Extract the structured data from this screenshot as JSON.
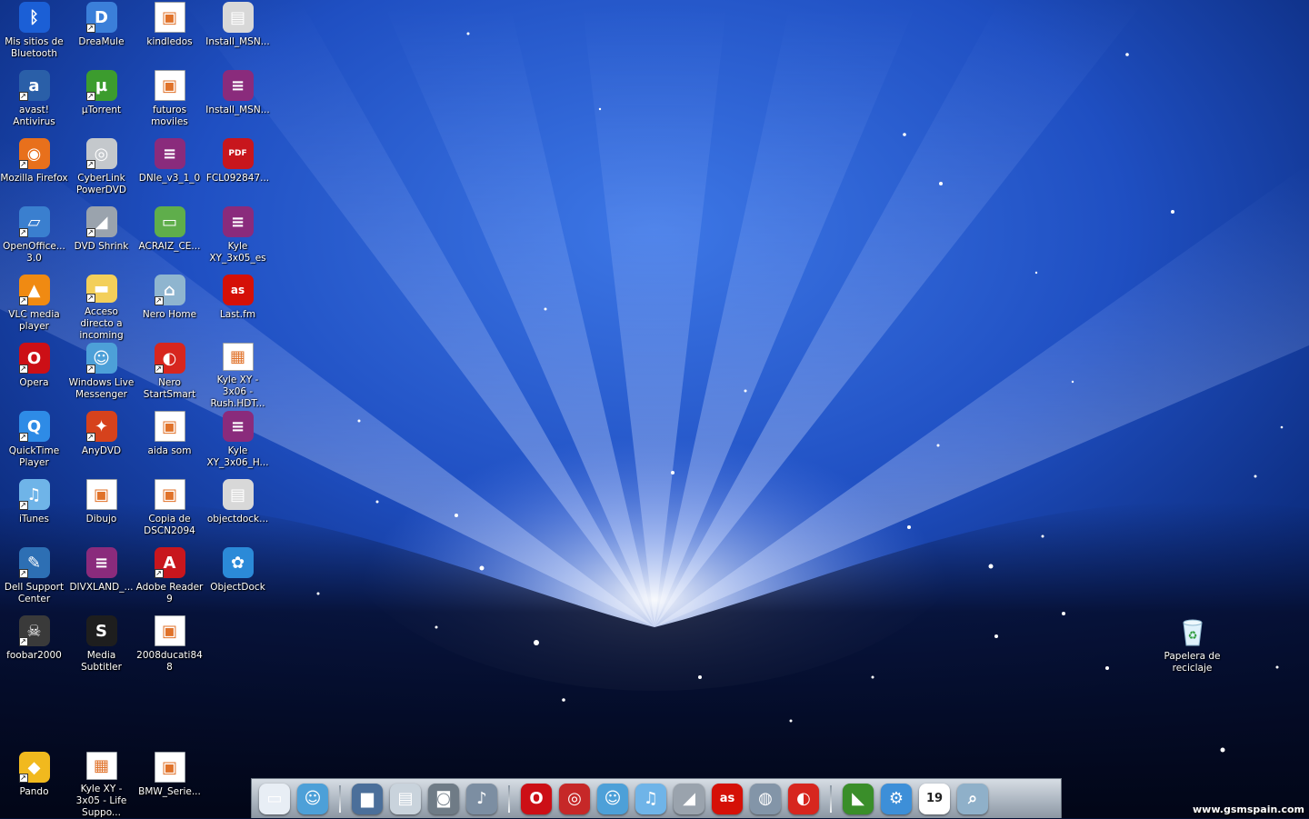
{
  "desktop": {
    "icons": [
      {
        "name": "bluetooth-icon",
        "label": "Mis sitios de Bluetooth",
        "shortcut": false,
        "color": "#1b5fd6",
        "glyph": "ᛒ"
      },
      {
        "name": "dreamule-icon",
        "label": "DreaMule",
        "shortcut": true,
        "color": "#3b7fd9",
        "glyph": "D"
      },
      {
        "name": "image-file-icon",
        "label": "kindledos",
        "shortcut": false,
        "color": "#ffffff",
        "glyph": "▣"
      },
      {
        "name": "installer-icon",
        "label": "Install_MSN...",
        "shortcut": false,
        "color": "#d8d8d8",
        "glyph": "▤"
      },
      {
        "name": "avast-icon",
        "label": "avast! Antivirus",
        "shortcut": true,
        "color": "#2a5fa8",
        "glyph": "a"
      },
      {
        "name": "utorrent-icon",
        "label": "µTorrent",
        "shortcut": true,
        "color": "#3c9c2e",
        "glyph": "µ"
      },
      {
        "name": "image-file-icon",
        "label": "futuros moviles",
        "shortcut": false,
        "color": "#ffffff",
        "glyph": "▣"
      },
      {
        "name": "archive-icon",
        "label": "Install_MSN...",
        "shortcut": false,
        "color": "#8a2b7c",
        "glyph": "≡"
      },
      {
        "name": "firefox-icon",
        "label": "Mozilla Firefox",
        "shortcut": true,
        "color": "#e8701c",
        "glyph": "◉"
      },
      {
        "name": "powerdvd-icon",
        "label": "CyberLink PowerDVD",
        "shortcut": true,
        "color": "#c4c8cc",
        "glyph": "◎"
      },
      {
        "name": "archive-icon",
        "label": "DNIe_v3_1_0",
        "shortcut": false,
        "color": "#8a2b7c",
        "glyph": "≡"
      },
      {
        "name": "pdf-file-icon",
        "label": "FCL092847...",
        "shortcut": false,
        "color": "#c8161d",
        "glyph": "PDF"
      },
      {
        "name": "openoffice-icon",
        "label": "OpenOffice... 3.0",
        "shortcut": true,
        "color": "#3a7fcf",
        "glyph": "▱"
      },
      {
        "name": "dvdshrink-icon",
        "label": "DVD Shrink",
        "shortcut": true,
        "color": "#9aa3ad",
        "glyph": "◢"
      },
      {
        "name": "certificate-icon",
        "label": "ACRAIZ_CE...",
        "shortcut": false,
        "color": "#5fae4b",
        "glyph": "▭"
      },
      {
        "name": "archive-icon",
        "label": "Kyle XY_3x05_es",
        "shortcut": false,
        "color": "#8a2b7c",
        "glyph": "≡"
      },
      {
        "name": "vlc-icon",
        "label": "VLC media player",
        "shortcut": true,
        "color": "#f08a12",
        "glyph": "▲"
      },
      {
        "name": "folder-icon",
        "label": "Acceso directo a incoming",
        "shortcut": true,
        "color": "#f3cf5a",
        "glyph": "▬"
      },
      {
        "name": "nero-home-icon",
        "label": "Nero Home",
        "shortcut": true,
        "color": "#8fb5cf",
        "glyph": "⌂"
      },
      {
        "name": "lastfm-icon",
        "label": "Last.fm",
        "shortcut": false,
        "color": "#d51007",
        "glyph": "as"
      },
      {
        "name": "opera-icon",
        "label": "Opera",
        "shortcut": true,
        "color": "#cc0f16",
        "glyph": "O"
      },
      {
        "name": "messenger-icon",
        "label": "Windows Live Messenger",
        "shortcut": true,
        "color": "#4da0d8",
        "glyph": "☺"
      },
      {
        "name": "nero-startsmart-icon",
        "label": "Nero StartSmart",
        "shortcut": true,
        "color": "#d7261e",
        "glyph": "◐"
      },
      {
        "name": "video-file-icon",
        "label": "Kyle XY - 3x06 - Rush.HDT...",
        "shortcut": false,
        "color": "#ffffff",
        "glyph": "▦"
      },
      {
        "name": "quicktime-icon",
        "label": "QuickTime Player",
        "shortcut": true,
        "color": "#2e8be6",
        "glyph": "Q"
      },
      {
        "name": "anydvd-icon",
        "label": "AnyDVD",
        "shortcut": true,
        "color": "#d6421c",
        "glyph": "✦"
      },
      {
        "name": "image-file-icon",
        "label": "aida som",
        "shortcut": false,
        "color": "#ffffff",
        "glyph": "▣"
      },
      {
        "name": "archive-icon",
        "label": "Kyle XY_3x06_H...",
        "shortcut": false,
        "color": "#8a2b7c",
        "glyph": "≡"
      },
      {
        "name": "itunes-icon",
        "label": "iTunes",
        "shortcut": true,
        "color": "#6fb4e8",
        "glyph": "♫"
      },
      {
        "name": "image-file-icon",
        "label": "Dibujo",
        "shortcut": false,
        "color": "#ffffff",
        "glyph": "▣"
      },
      {
        "name": "image-file-icon",
        "label": "Copia de DSCN2094",
        "shortcut": false,
        "color": "#ffffff",
        "glyph": "▣"
      },
      {
        "name": "installer-icon",
        "label": "objectdock...",
        "shortcut": false,
        "color": "#d8d8d8",
        "glyph": "▤"
      },
      {
        "name": "dell-support-icon",
        "label": "Dell Support Center",
        "shortcut": true,
        "color": "#2d6fb4",
        "glyph": "✎"
      },
      {
        "name": "archive-icon",
        "label": "DIVXLAND_...",
        "shortcut": false,
        "color": "#8a2b7c",
        "glyph": "≡"
      },
      {
        "name": "adobe-reader-icon",
        "label": "Adobe Reader 9",
        "shortcut": true,
        "color": "#c8161d",
        "glyph": "A"
      },
      {
        "name": "objectdock-icon",
        "label": "ObjectDock",
        "shortcut": false,
        "color": "#2b8ad8",
        "glyph": "✿"
      },
      {
        "name": "foobar-icon",
        "label": "foobar2000",
        "shortcut": true,
        "color": "#3a3a3a",
        "glyph": "☠"
      },
      {
        "name": "media-subtitler-icon",
        "label": "Media Subtitler",
        "shortcut": false,
        "color": "#1e1e1e",
        "glyph": "S"
      },
      {
        "name": "image-file-icon",
        "label": "2008ducati848",
        "shortcut": false,
        "color": "#ffffff",
        "glyph": "▣"
      }
    ],
    "bottom_icons": [
      {
        "name": "pando-icon",
        "label": "Pando",
        "shortcut": true,
        "color": "#f1b91e",
        "glyph": "◆"
      },
      {
        "name": "video-file-icon",
        "label": "Kyle XY - 3x05 - Life Suppo...",
        "shortcut": false,
        "color": "#ffffff",
        "glyph": "▦"
      },
      {
        "name": "image-file-icon",
        "label": "BMW_Serie...",
        "shortcut": false,
        "color": "#ffffff",
        "glyph": "▣"
      }
    ],
    "recycle_bin": {
      "name": "recycle-bin-icon",
      "label": "Papelera de reciclaje",
      "color": "#bfe3f5",
      "glyph": "♻"
    }
  },
  "dock": {
    "groups": [
      [
        {
          "name": "window-dock-icon",
          "color": "#e8eef5",
          "glyph": "▭"
        },
        {
          "name": "messenger-dock-icon",
          "color": "#4da0d8",
          "glyph": "☺"
        }
      ],
      [
        {
          "name": "monitor-dock-icon",
          "color": "#4b6f9a",
          "glyph": "▆"
        },
        {
          "name": "documents-dock-icon",
          "color": "#c9d3dc",
          "glyph": "▤"
        },
        {
          "name": "camera-dock-icon",
          "color": "#6f7b86",
          "glyph": "◙"
        },
        {
          "name": "music-dock-icon",
          "color": "#7c8ea2",
          "glyph": "♪"
        }
      ],
      [
        {
          "name": "opera-dock-icon",
          "color": "#cc0f16",
          "glyph": "O"
        },
        {
          "name": "dvd-dock-icon",
          "color": "#c62828",
          "glyph": "◎"
        },
        {
          "name": "messenger-dock-icon",
          "color": "#4da0d8",
          "glyph": "☺"
        },
        {
          "name": "itunes-dock-icon",
          "color": "#6fb4e8",
          "glyph": "♫"
        },
        {
          "name": "dvdshrink-dock-icon",
          "color": "#9aa3ad",
          "glyph": "◢"
        },
        {
          "name": "lastfm-dock-icon",
          "color": "#d51007",
          "glyph": "as"
        },
        {
          "name": "network-dock-icon",
          "color": "#8395a8",
          "glyph": "◍"
        },
        {
          "name": "nero-dock-icon",
          "color": "#d7261e",
          "glyph": "◐"
        }
      ],
      [
        {
          "name": "crocodile-dock-icon",
          "color": "#3a8e2a",
          "glyph": "◣"
        },
        {
          "name": "settings-dock-icon",
          "color": "#3d8fd8",
          "glyph": "⚙"
        },
        {
          "name": "calendar-dock-icon",
          "color": "#ffffff",
          "glyph": "19"
        },
        {
          "name": "search-dock-icon",
          "color": "#8fb0c9",
          "glyph": "⌕"
        }
      ]
    ]
  },
  "watermark": "www.gsmspain.com"
}
